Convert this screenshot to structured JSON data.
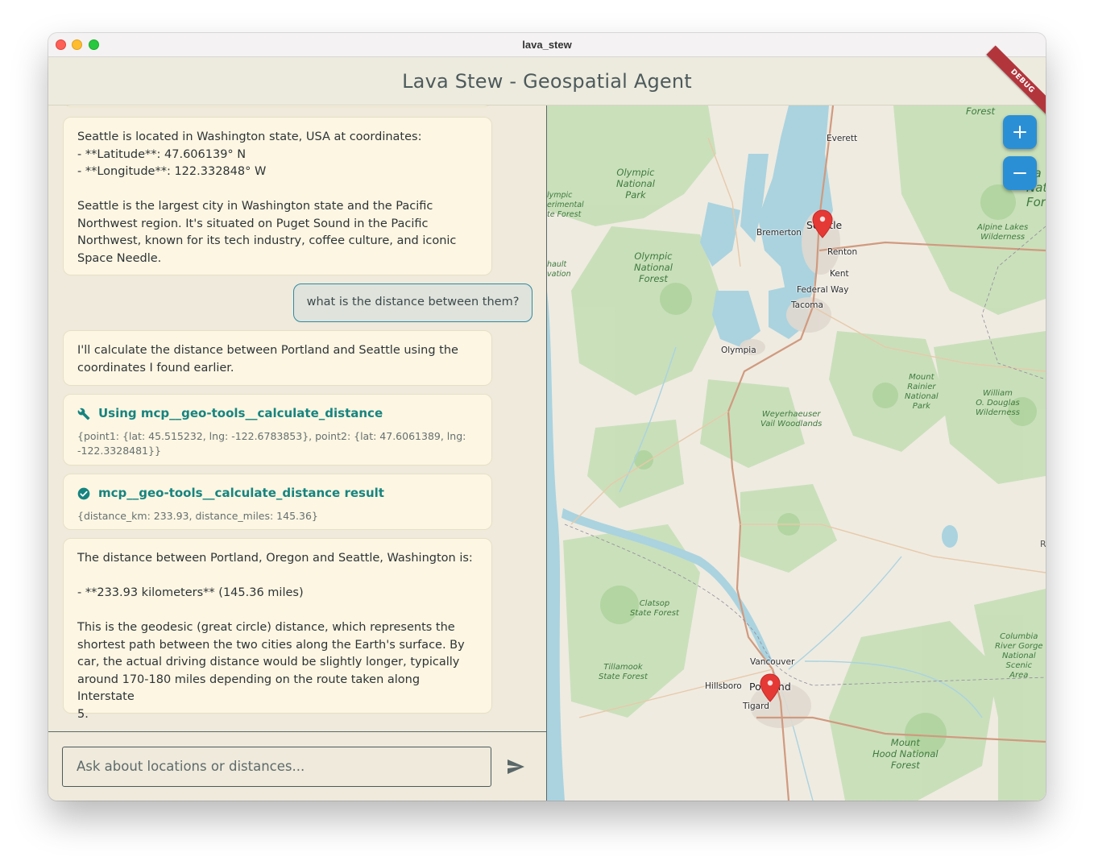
{
  "window": {
    "title": "lava_stew"
  },
  "appbar": {
    "title": "Lava Stew - Geospatial Agent",
    "debug_badge": "DEBUG"
  },
  "chat": {
    "messages": [
      {
        "role": "assistant",
        "text": "Seattle is located in Washington state, USA at coordinates:\n- **Latitude**: 47.606139° N\n- **Longitude**: 122.332848° W\n\nSeattle is the largest city in Washington state and the Pacific\nNorthwest region. It's situated on Puget Sound in the Pacific\nNorthwest, known for its tech industry, coffee culture, and iconic\nSpace Needle."
      },
      {
        "role": "user",
        "text": "what is the distance between them?"
      },
      {
        "role": "assistant",
        "text": "I'll calculate the distance between Portland and Seattle using the\ncoordinates I found earlier."
      },
      {
        "role": "tool_call",
        "title": "Using mcp__geo-tools__calculate_distance",
        "args": "{point1: {lat: 45.515232, lng: -122.6783853}, point2: {lat: 47.6061389, lng:\n-122.3328481}}",
        "icon": "wrench-icon"
      },
      {
        "role": "tool_result",
        "title": "mcp__geo-tools__calculate_distance result",
        "args": "{distance_km: 233.93, distance_miles: 145.36}",
        "icon": "check-circle-icon"
      },
      {
        "role": "assistant",
        "text": "The distance between Portland, Oregon and Seattle, Washington is:\n\n- **233.93 kilometers** (145.36 miles)\n\nThis is the geodesic (great circle) distance, which represents the\nshortest path between the two cities along the Earth's surface. By\ncar, the actual driving distance would be slightly longer, typically\naround 170-180 miles depending on the route taken along Interstate\n5."
      }
    ],
    "input": {
      "placeholder": "Ask about locations or distances...",
      "value": ""
    },
    "send_icon": "send-icon"
  },
  "map": {
    "zoom_in_icon": "plus-icon",
    "zoom_out_icon": "minus-icon",
    "markers": [
      {
        "name": "Seattle",
        "icon": "map-pin-icon"
      },
      {
        "name": "Portland",
        "icon": "map-pin-icon"
      }
    ],
    "labels": {
      "everett": "Everett",
      "seattle": "Seattle",
      "bremerton": "Bremerton",
      "renton": "Renton",
      "kent": "Kent",
      "federal_way": "Federal Way",
      "tacoma": "Tacoma",
      "olympia": "Olympia",
      "vancouver": "Vancouver",
      "hillsboro": "Hillsboro",
      "portland": "Portland",
      "tigard": "Tigard",
      "forest_top": "Forest",
      "olympic_np": "Olympic\nNational\nPark",
      "olympic_nf": "Olympic\nNational\nForest",
      "olympic_exp": "lympic\nerimental\nte Forest",
      "rainier": "Mount\nRainier\nNational\nPark",
      "alpine": "Alpine Lakes\nWilderness",
      "douglas": "William\nO. Douglas\nWilderness",
      "weyerhaeuser": "Weyerhaeuser\nVail Woodlands",
      "clatsop": "Clatsop\nState Forest",
      "tillamook": "Tillamook\nState Forest",
      "columbia": "Columbia\nRiver Gorge\nNational\nScenic\nArea",
      "hood": "Mount\nHood National\nForest",
      "national_right": "na\nNati\nFor",
      "hault": "hault\nvation",
      "edge_r": "R"
    }
  },
  "colors": {
    "accent": "#16847f",
    "user_border": "#2f8aa3",
    "marker": "#e53935",
    "zoom_button": "#2b8fd6",
    "bubble_bg": "#fcf6e3",
    "app_bg": "#efeadb"
  }
}
